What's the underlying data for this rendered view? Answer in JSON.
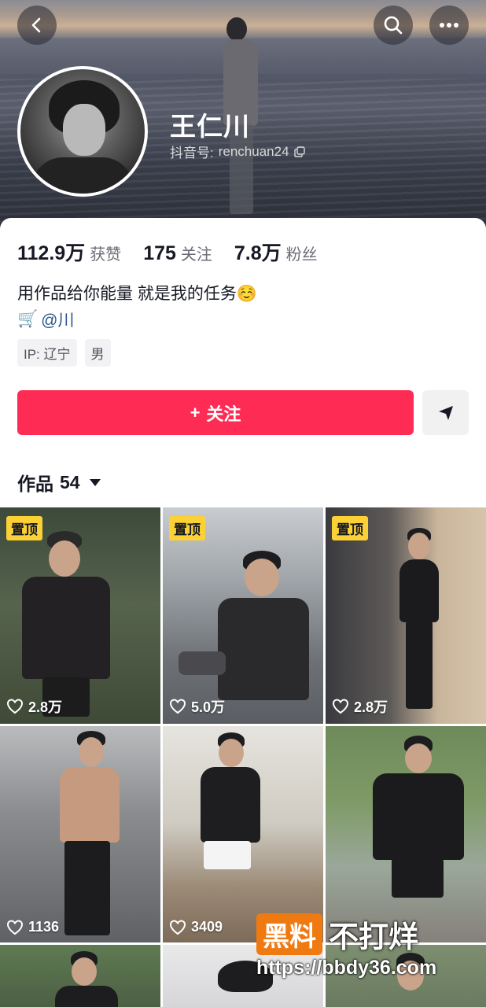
{
  "profile": {
    "name": "王仁川",
    "douyin_id_label": "抖音号:",
    "douyin_id": "renchuan24",
    "bio": "用作品给你能量 就是我的任务☺️",
    "shop_icon": "🛒",
    "shop_link": "@川",
    "tags": [
      "IP: 辽宁",
      "男"
    ]
  },
  "stats": [
    {
      "num": "112.9万",
      "label": "获赞"
    },
    {
      "num": "175",
      "label": "关注"
    },
    {
      "num": "7.8万",
      "label": "粉丝"
    }
  ],
  "actions": {
    "follow_label": "关注",
    "follow_plus": "+"
  },
  "works": {
    "label": "作品",
    "count": "54"
  },
  "videos": [
    {
      "pinned": "置顶",
      "likes": "2.8万"
    },
    {
      "pinned": "置顶",
      "likes": "5.0万"
    },
    {
      "pinned": "置顶",
      "likes": "2.8万"
    },
    {
      "pinned": "",
      "likes": "1136"
    },
    {
      "pinned": "",
      "likes": "3409"
    },
    {
      "pinned": "",
      "likes": ""
    }
  ],
  "watermark": {
    "brand_box": "黑料",
    "brand_text": "不打烊",
    "url": "https://bbdy36.com"
  },
  "colors": {
    "accent": "#fe2c55",
    "pin_badge": "#fcd135",
    "link": "#2b5a8c"
  },
  "icons": [
    "back-icon",
    "search-icon",
    "more-icon",
    "copy-icon",
    "send-icon",
    "heart-icon",
    "caret-down-icon"
  ]
}
